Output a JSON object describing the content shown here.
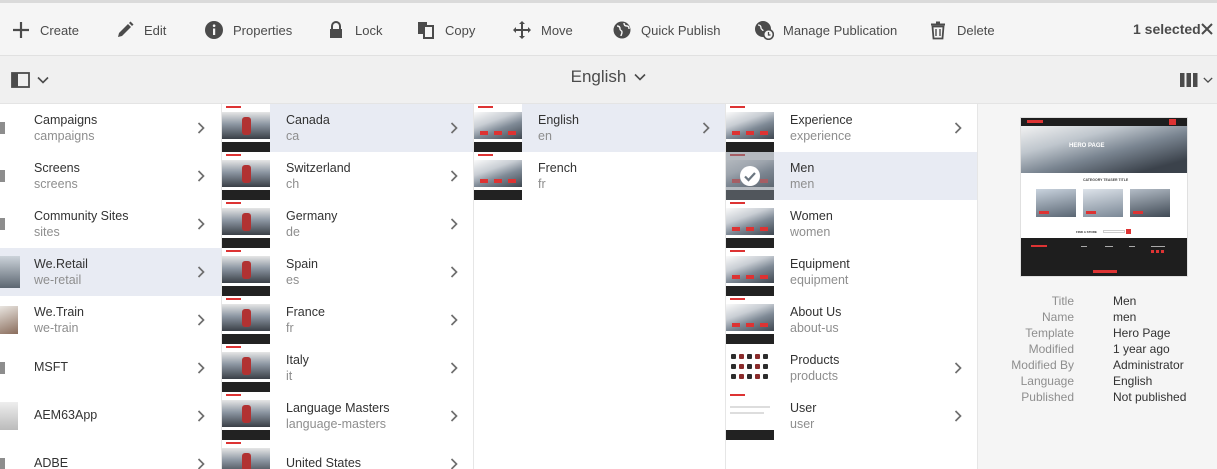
{
  "actionbar": {
    "items": [
      {
        "label": "Create",
        "icon": "plus-icon"
      },
      {
        "label": "Edit",
        "icon": "pencil-icon"
      },
      {
        "label": "Properties",
        "icon": "info-icon"
      },
      {
        "label": "Lock",
        "icon": "lock-icon"
      },
      {
        "label": "Copy",
        "icon": "copy-icon"
      },
      {
        "label": "Move",
        "icon": "move-icon"
      },
      {
        "label": "Quick Publish",
        "icon": "globe-icon"
      },
      {
        "label": "Manage Publication",
        "icon": "globe-clock-icon"
      },
      {
        "label": "Delete",
        "icon": "trash-icon"
      }
    ],
    "selection_count": "1 selected"
  },
  "header": {
    "title": "English"
  },
  "columns": [
    {
      "items": [
        {
          "title": "Campaigns",
          "name": "campaigns",
          "has_children": true
        },
        {
          "title": "Screens",
          "name": "screens",
          "has_children": true
        },
        {
          "title": "Community Sites",
          "name": "sites",
          "has_children": true
        },
        {
          "title": "We.Retail",
          "name": "we-retail",
          "has_children": true,
          "active": true
        },
        {
          "title": "We.Train",
          "name": "we-train",
          "has_children": true
        },
        {
          "title": "MSFT",
          "name": "",
          "has_children": true
        },
        {
          "title": "AEM63App",
          "name": "",
          "has_children": true
        },
        {
          "title": "ADBE",
          "name": "",
          "has_children": true
        }
      ]
    },
    {
      "items": [
        {
          "title": "Canada",
          "name": "ca",
          "has_children": true,
          "active": true
        },
        {
          "title": "Switzerland",
          "name": "ch",
          "has_children": true
        },
        {
          "title": "Germany",
          "name": "de",
          "has_children": true
        },
        {
          "title": "Spain",
          "name": "es",
          "has_children": true
        },
        {
          "title": "France",
          "name": "fr",
          "has_children": true
        },
        {
          "title": "Italy",
          "name": "it",
          "has_children": true
        },
        {
          "title": "Language Masters",
          "name": "language-masters",
          "has_children": true
        },
        {
          "title": "United States",
          "name": "",
          "has_children": true
        }
      ]
    },
    {
      "items": [
        {
          "title": "English",
          "name": "en",
          "has_children": true,
          "active": true
        },
        {
          "title": "French",
          "name": "fr",
          "has_children": false
        }
      ]
    },
    {
      "items": [
        {
          "title": "Experience",
          "name": "experience",
          "has_children": true
        },
        {
          "title": "Men",
          "name": "men",
          "has_children": false,
          "selected": true
        },
        {
          "title": "Women",
          "name": "women",
          "has_children": false
        },
        {
          "title": "Equipment",
          "name": "equipment",
          "has_children": false
        },
        {
          "title": "About Us",
          "name": "about-us",
          "has_children": false
        },
        {
          "title": "Products",
          "name": "products",
          "has_children": true
        },
        {
          "title": "User",
          "name": "user",
          "has_children": true
        }
      ]
    }
  ],
  "preview": {
    "thumbnail_text": {
      "hero": "HERO PAGE",
      "section": "CATEGORY TEASER TITLE",
      "find": "FIND A STORE"
    },
    "metadata": [
      {
        "key": "Title",
        "value": "Men"
      },
      {
        "key": "Name",
        "value": "men"
      },
      {
        "key": "Template",
        "value": "Hero Page"
      },
      {
        "key": "Modified",
        "value": "1 year ago"
      },
      {
        "key": "Modified By",
        "value": "Administrator"
      },
      {
        "key": "Language",
        "value": "English"
      },
      {
        "key": "Published",
        "value": "Not published"
      }
    ]
  },
  "colors": {
    "accent": "#2680eb",
    "active_row": "#e8ebf3",
    "brand_red": "#d33"
  }
}
